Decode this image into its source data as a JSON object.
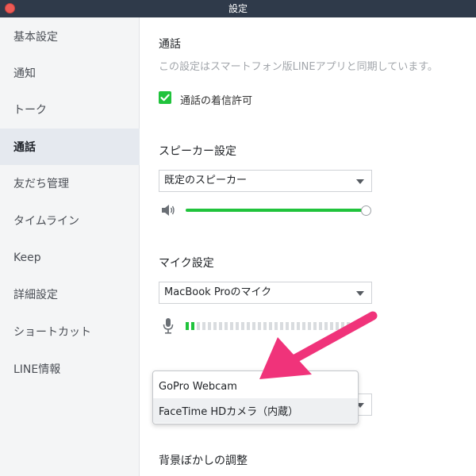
{
  "window": {
    "title": "設定"
  },
  "sidebar": {
    "items": [
      {
        "label": "基本設定"
      },
      {
        "label": "通知"
      },
      {
        "label": "トーク"
      },
      {
        "label": "通話"
      },
      {
        "label": "友だち管理"
      },
      {
        "label": "タイムライン"
      },
      {
        "label": "Keep"
      },
      {
        "label": "詳細設定"
      },
      {
        "label": "ショートカット"
      },
      {
        "label": "LINE情報"
      }
    ],
    "active": "通話"
  },
  "calls": {
    "title": "通話",
    "sync_note": "この設定はスマートフォン版LINEアプリと同期しています。",
    "allow_incoming": {
      "label": "通話の着信許可",
      "checked": true
    }
  },
  "speaker": {
    "title": "スピーカー設定",
    "selected": "既定のスピーカー",
    "volume_fraction": 1.0
  },
  "mic": {
    "title": "マイク設定",
    "selected": "MacBook Proのマイク",
    "level_active_bars": 2,
    "level_total_bars": 30
  },
  "camera": {
    "options": [
      "GoPro Webcam",
      "FaceTime HDカメラ（内蔵）"
    ],
    "highlighted": "FaceTime HDカメラ（内蔵）"
  },
  "background_blur": {
    "title": "背景ぼかしの調整"
  },
  "colors": {
    "accent": "#20c33c",
    "arrow": "#f0337a",
    "titlebar": "#2f3a4a"
  }
}
